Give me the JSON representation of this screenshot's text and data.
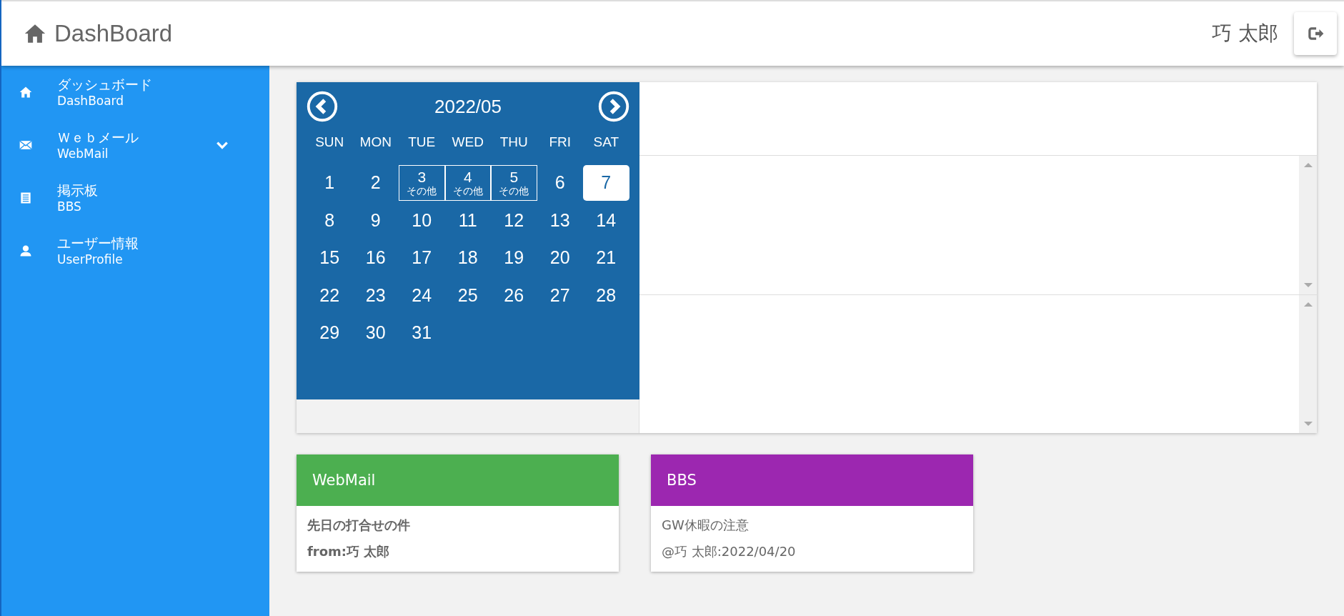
{
  "header": {
    "title": "DashBoard",
    "user": "巧 太郎"
  },
  "sidebar": {
    "items": [
      {
        "kind": "home",
        "label": "ダッシュボード",
        "sublabel": "DashBoard",
        "has_submenu": false
      },
      {
        "kind": "mail",
        "label": "Ｗｅｂメール",
        "sublabel": "WebMail",
        "has_submenu": true
      },
      {
        "kind": "list",
        "label": "掲示板",
        "sublabel": "BBS",
        "has_submenu": false
      },
      {
        "kind": "user",
        "label": "ユーザー情報",
        "sublabel": "UserProfile",
        "has_submenu": false
      }
    ]
  },
  "calendar": {
    "month": "2022/05",
    "weekdays": [
      "SUN",
      "MON",
      "TUE",
      "WED",
      "THU",
      "FRI",
      "SAT"
    ],
    "weeks": [
      [
        {
          "day": "1",
          "today": false
        },
        {
          "day": "2",
          "today": false
        },
        {
          "day": "3",
          "note": "その他",
          "today": false
        },
        {
          "day": "4",
          "note": "その他",
          "today": false
        },
        {
          "day": "5",
          "note": "その他",
          "today": false
        },
        {
          "day": "6",
          "today": false
        },
        {
          "day": "7",
          "today": true
        }
      ],
      [
        {
          "day": "8",
          "today": false
        },
        {
          "day": "9",
          "today": false
        },
        {
          "day": "10",
          "today": false
        },
        {
          "day": "11",
          "today": false
        },
        {
          "day": "12",
          "today": false
        },
        {
          "day": "13",
          "today": false
        },
        {
          "day": "14",
          "today": false
        }
      ],
      [
        {
          "day": "15",
          "today": false
        },
        {
          "day": "16",
          "today": false
        },
        {
          "day": "17",
          "today": false
        },
        {
          "day": "18",
          "today": false
        },
        {
          "day": "19",
          "today": false
        },
        {
          "day": "20",
          "today": false
        },
        {
          "day": "21",
          "today": false
        }
      ],
      [
        {
          "day": "22",
          "today": false
        },
        {
          "day": "23",
          "today": false
        },
        {
          "day": "24",
          "today": false
        },
        {
          "day": "25",
          "today": false
        },
        {
          "day": "26",
          "today": false
        },
        {
          "day": "27",
          "today": false
        },
        {
          "day": "28",
          "today": false
        }
      ],
      [
        {
          "day": "29",
          "today": false
        },
        {
          "day": "30",
          "today": false
        },
        {
          "day": "31",
          "today": false
        }
      ]
    ]
  },
  "cards": [
    {
      "title": "WebMail",
      "color": "#4caf50",
      "bold": true,
      "lines": [
        "先日の打合せの件",
        "from:巧 太郎"
      ]
    },
    {
      "title": "BBS",
      "color": "#9c27b0",
      "bold": false,
      "lines": [
        "GW休暇の注意",
        "@巧 太郎:2022/04/20"
      ]
    }
  ]
}
